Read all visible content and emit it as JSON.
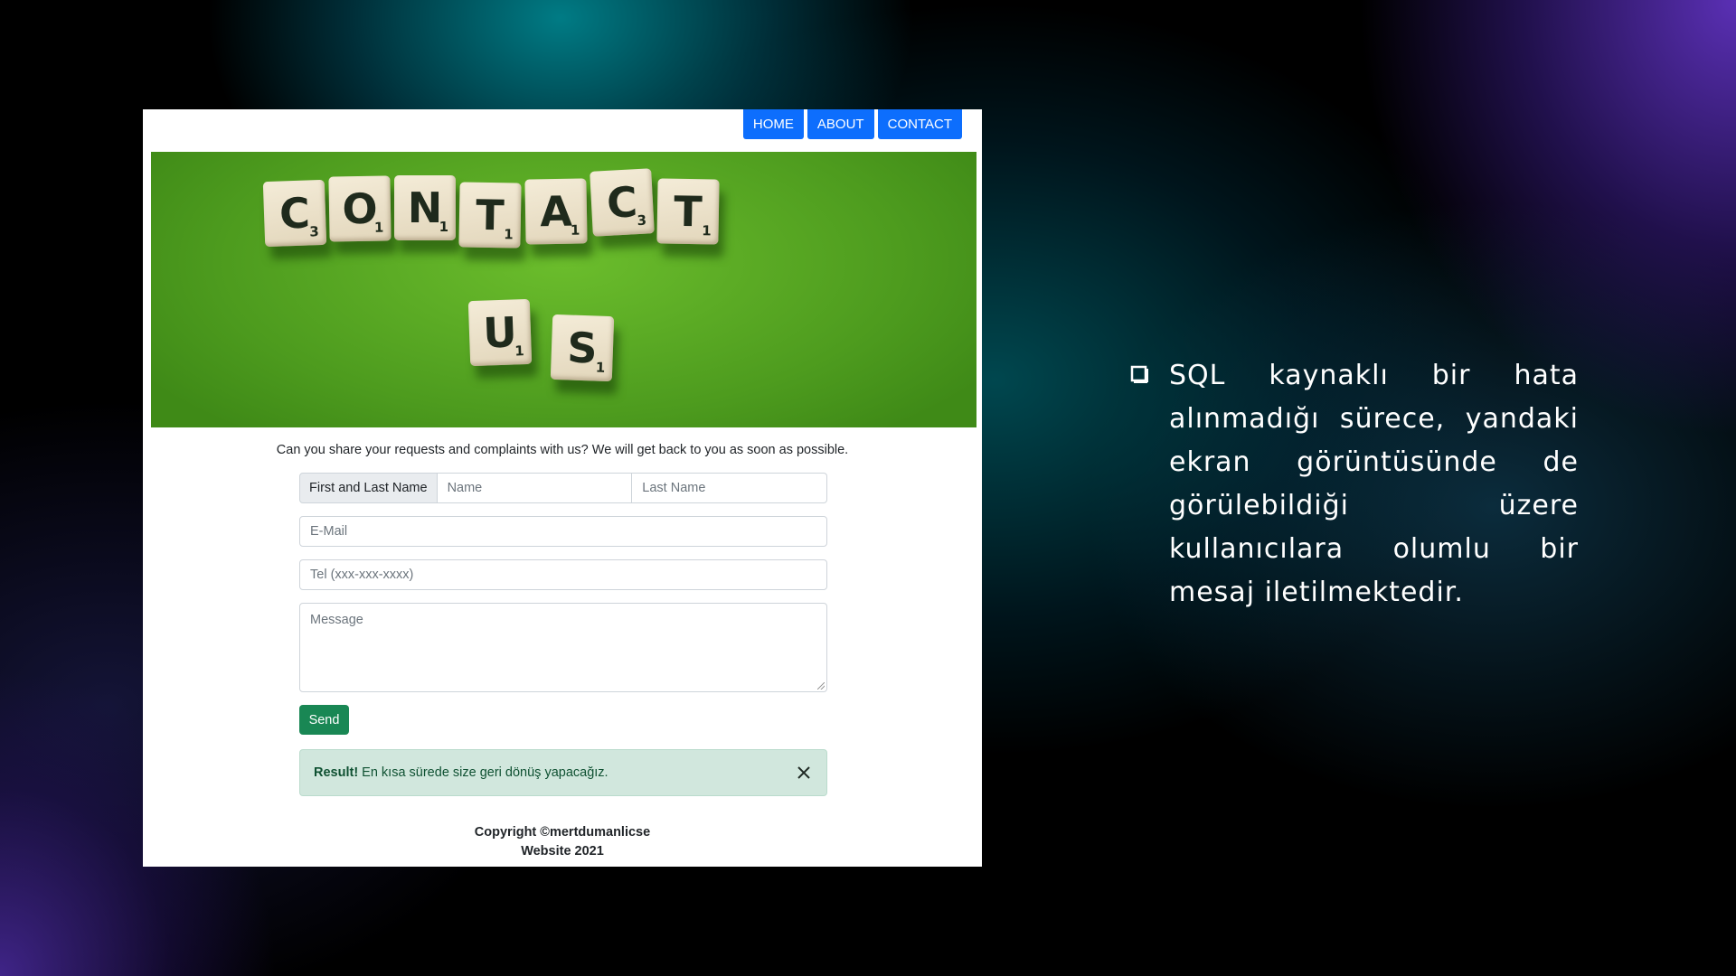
{
  "navbar": {
    "items": [
      {
        "label": "HOME"
      },
      {
        "label": "ABOUT"
      },
      {
        "label": "CONTACT"
      }
    ]
  },
  "hero": {
    "row1": [
      "C",
      "O",
      "N",
      "T",
      "A",
      "C",
      "T"
    ],
    "row1_scores": [
      "3",
      "1",
      "1",
      "1",
      "1",
      "3",
      "1"
    ],
    "row2": [
      "U",
      "S"
    ],
    "row2_scores": [
      "1",
      "1"
    ]
  },
  "intro_text": "Can you share your requests and complaints with us? We will get back to you as soon as possible.",
  "form": {
    "name_label": "First and Last Name",
    "name_placeholder": "Name",
    "last_name_placeholder": "Last Name",
    "email_placeholder": "E-Mail",
    "tel_placeholder": "Tel (xxx-xxx-xxxx)",
    "message_placeholder": "Message",
    "send_label": "Send"
  },
  "alert": {
    "title": "Result!",
    "message": "En kısa sürede size geri dönüş yapacağız."
  },
  "footer": {
    "line1": "Copyright ©mertdumanlicse",
    "line2": "Website 2021"
  },
  "slide_text": "SQL kaynaklı bir hata alınmadığı sürece, yandaki ekran görüntüsünde de görülebildiği üzere kullanıcılara olumlu bir mesaj iletilmektedir.",
  "colors": {
    "nav_button": "#0d6efd",
    "send_button": "#198754",
    "alert_bg": "#d1e7dd",
    "alert_text": "#0f5132"
  }
}
